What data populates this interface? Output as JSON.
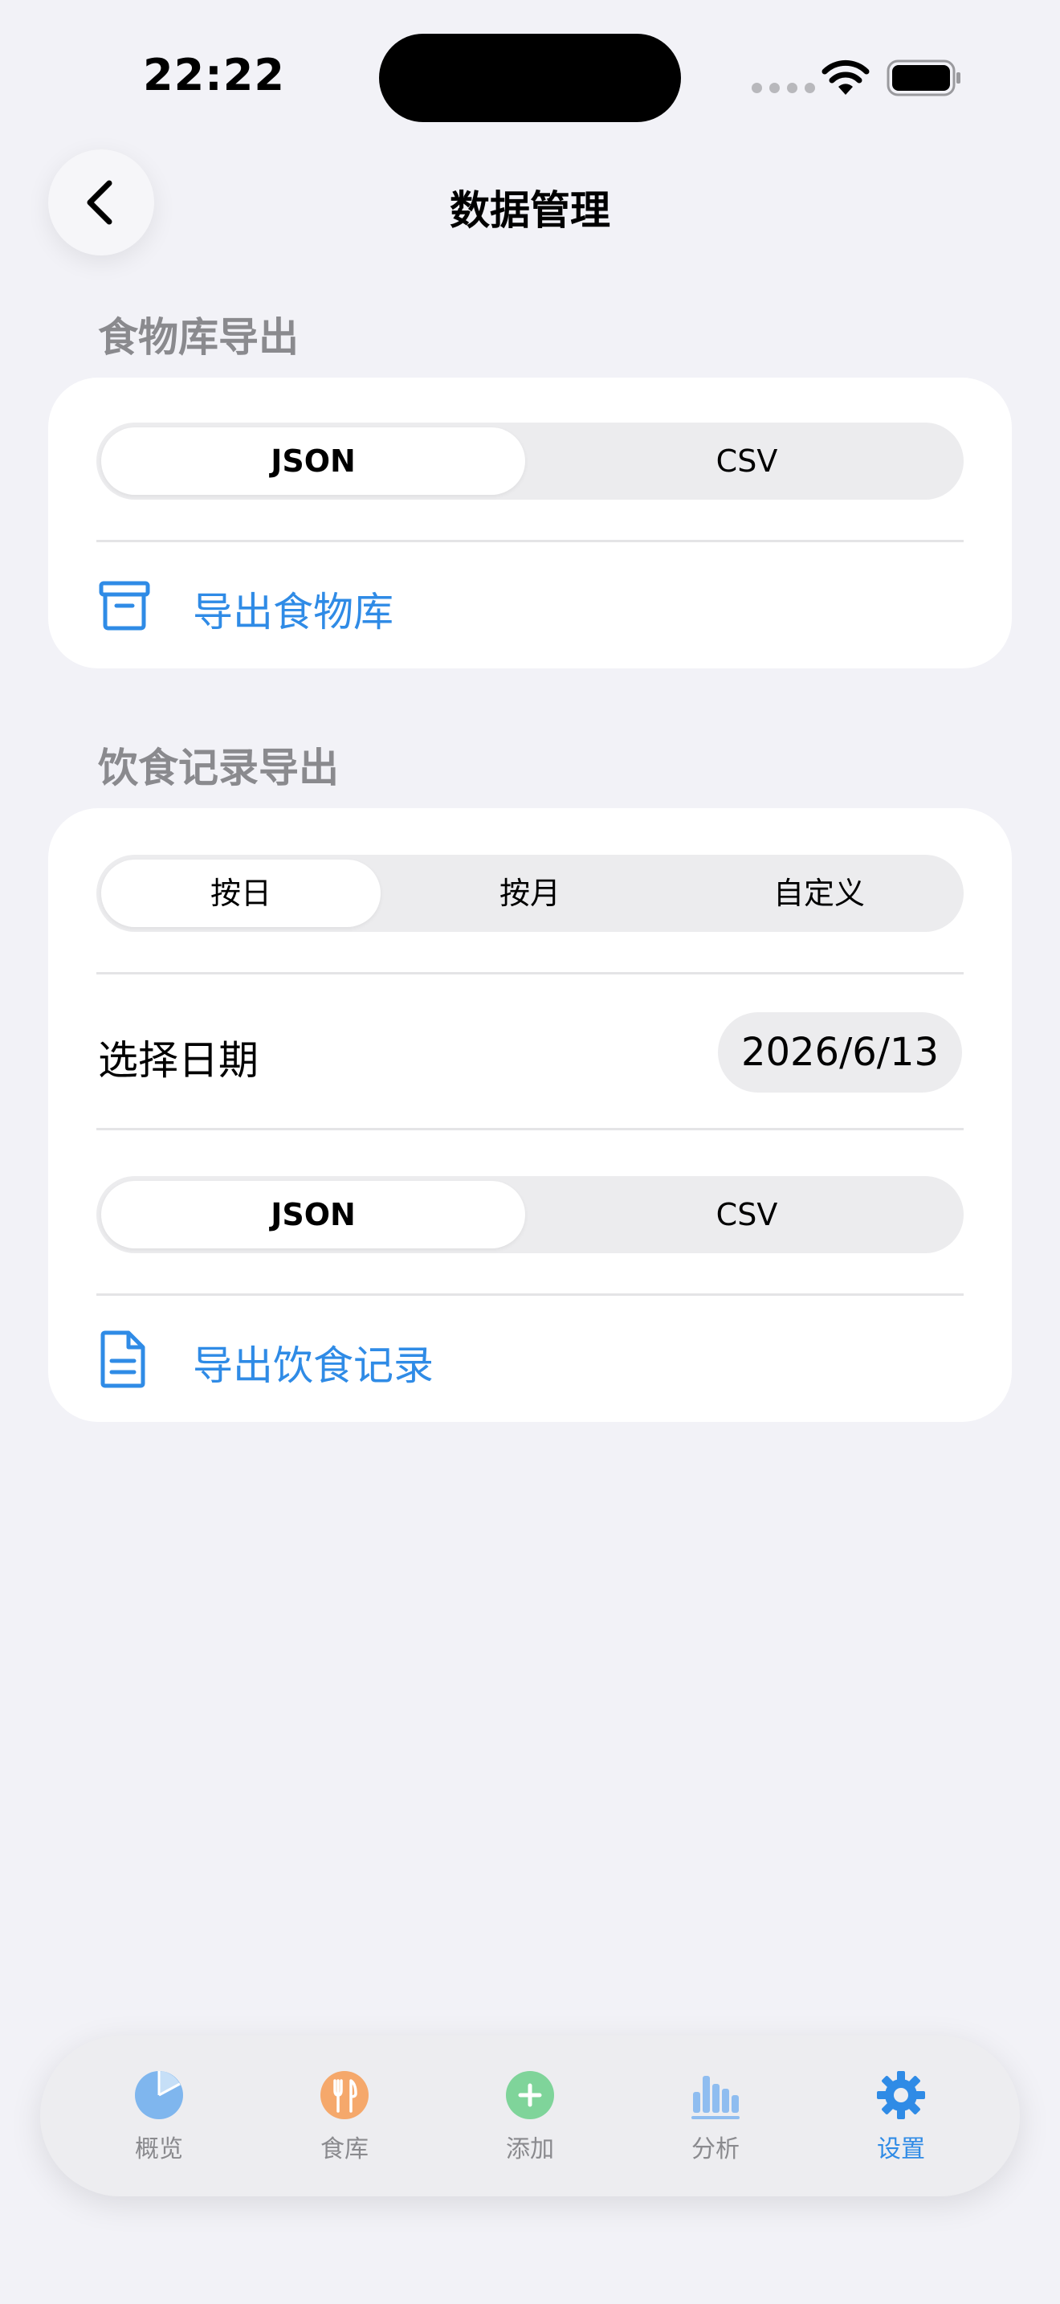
{
  "status_bar": {
    "time": "22:22"
  },
  "nav": {
    "title": "数据管理"
  },
  "food_export": {
    "section_title": "食物库导出",
    "format_options": [
      "JSON",
      "CSV"
    ],
    "selected_format": "JSON",
    "action_label": "导出食物库"
  },
  "diet_export": {
    "section_title": "饮食记录导出",
    "range_options": [
      "按日",
      "按月",
      "自定义"
    ],
    "selected_range": "按日",
    "date_label": "选择日期",
    "date_value": "2026/6/13",
    "format_options": [
      "JSON",
      "CSV"
    ],
    "selected_format": "JSON",
    "action_label": "导出饮食记录"
  },
  "tab_bar": {
    "items": [
      {
        "label": "概览",
        "icon": "pie-chart-icon",
        "color": "#7fb6ee"
      },
      {
        "label": "食库",
        "icon": "fork-knife-icon",
        "color": "#f5a86b"
      },
      {
        "label": "添加",
        "icon": "plus-circle-icon",
        "color": "#7fd49a"
      },
      {
        "label": "分析",
        "icon": "bar-chart-icon",
        "color": "#8fbdf0"
      },
      {
        "label": "设置",
        "icon": "gear-icon",
        "color": "#2f8be6"
      }
    ],
    "active": "设置"
  },
  "colors": {
    "accent": "#2f8be6",
    "background": "#f2f2f7"
  }
}
